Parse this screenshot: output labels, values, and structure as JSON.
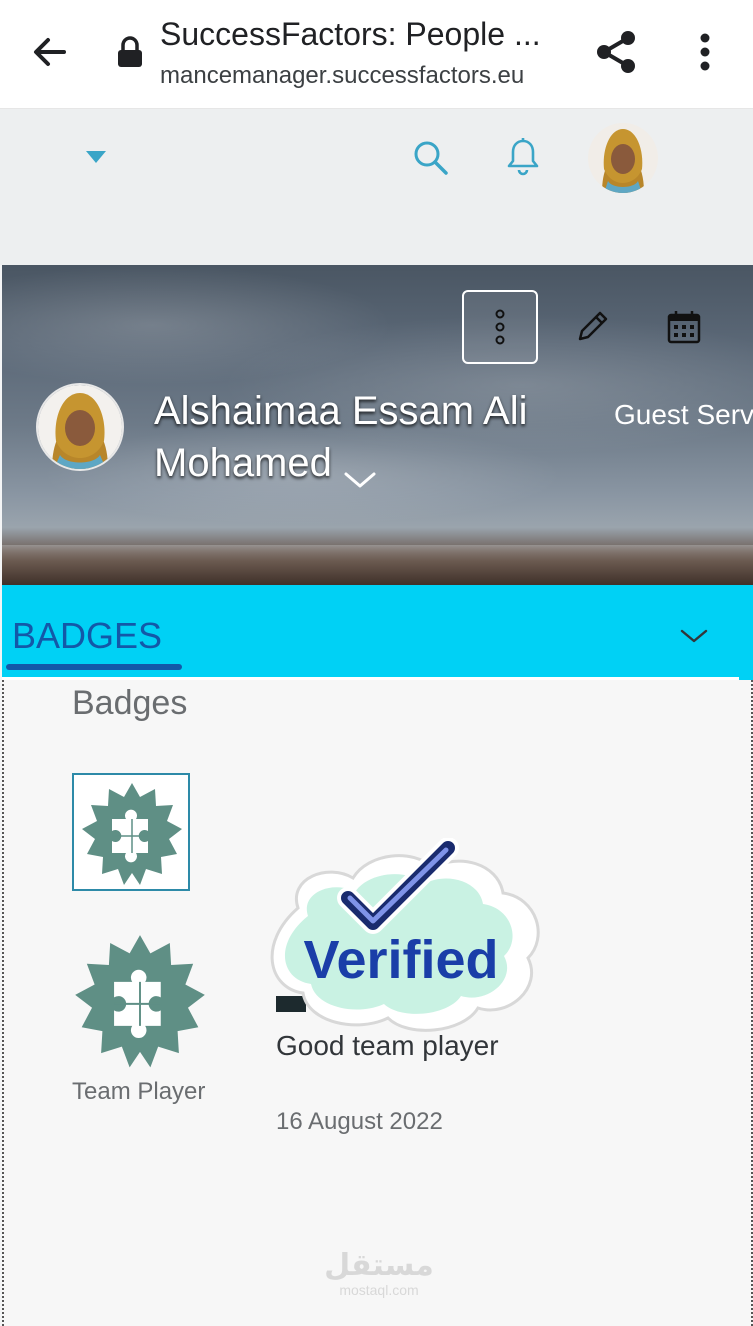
{
  "browser": {
    "page_title": "SuccessFactors: People ...",
    "url": "mancemanager.successfactors.eu"
  },
  "profile": {
    "name": "Alshaimaa Essam Ali Mohamed",
    "job_title": "Guest Serv"
  },
  "section": {
    "tab_label": "BADGES"
  },
  "badges": {
    "heading": "Badges",
    "items": [
      {
        "name": "Team Player",
        "comment": "Good team player",
        "date": "16 August 2022"
      }
    ]
  },
  "sticker": {
    "text": "Verified"
  },
  "watermark": {
    "main": "مستقل",
    "sub": "mostaql.com"
  },
  "colors": {
    "section_bar": "#00d1f5",
    "section_tab_text": "#1358a8",
    "icon_accent": "#3aa5c7",
    "badge_green": "#5f8f85",
    "verified_blue": "#1a3ea8"
  }
}
